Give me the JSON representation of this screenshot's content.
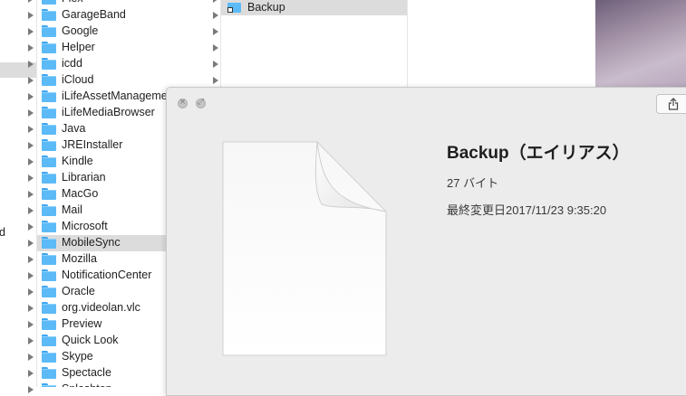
{
  "column0": {
    "stray_text": "d"
  },
  "column1": {
    "items": [
      {
        "label": "Flex"
      },
      {
        "label": "GarageBand"
      },
      {
        "label": "Google"
      },
      {
        "label": "Helper"
      },
      {
        "label": "icdd"
      },
      {
        "label": "iCloud"
      },
      {
        "label": "iLifeAssetManagement"
      },
      {
        "label": "iLifeMediaBrowser"
      },
      {
        "label": "Java"
      },
      {
        "label": "JREInstaller"
      },
      {
        "label": "Kindle"
      },
      {
        "label": "Librarian"
      },
      {
        "label": "MacGo"
      },
      {
        "label": "Mail"
      },
      {
        "label": "Microsoft"
      },
      {
        "label": "MobileSync",
        "selected": true
      },
      {
        "label": "Mozilla"
      },
      {
        "label": "NotificationCenter"
      },
      {
        "label": "Oracle"
      },
      {
        "label": "org.videolan.vlc"
      },
      {
        "label": "Preview"
      },
      {
        "label": "Quick Look"
      },
      {
        "label": "Skype"
      },
      {
        "label": "Spectacle"
      },
      {
        "label": "Splashtop"
      }
    ]
  },
  "column2": {
    "items": [
      {
        "label": "Backup",
        "selected": true,
        "icon": "alias-folder-icon"
      }
    ]
  },
  "quicklook": {
    "title": "Backup（エイリアス）",
    "size": "27 バイト",
    "modified": "最終変更日2017/11/23 9:35:20",
    "close_glyph": "×",
    "fullscreen_glyph": "⤢"
  },
  "colors": {
    "folder_blue": "#5cbaf7",
    "selection_gray": "#dcdcdc",
    "panel_bg": "#ececec"
  }
}
